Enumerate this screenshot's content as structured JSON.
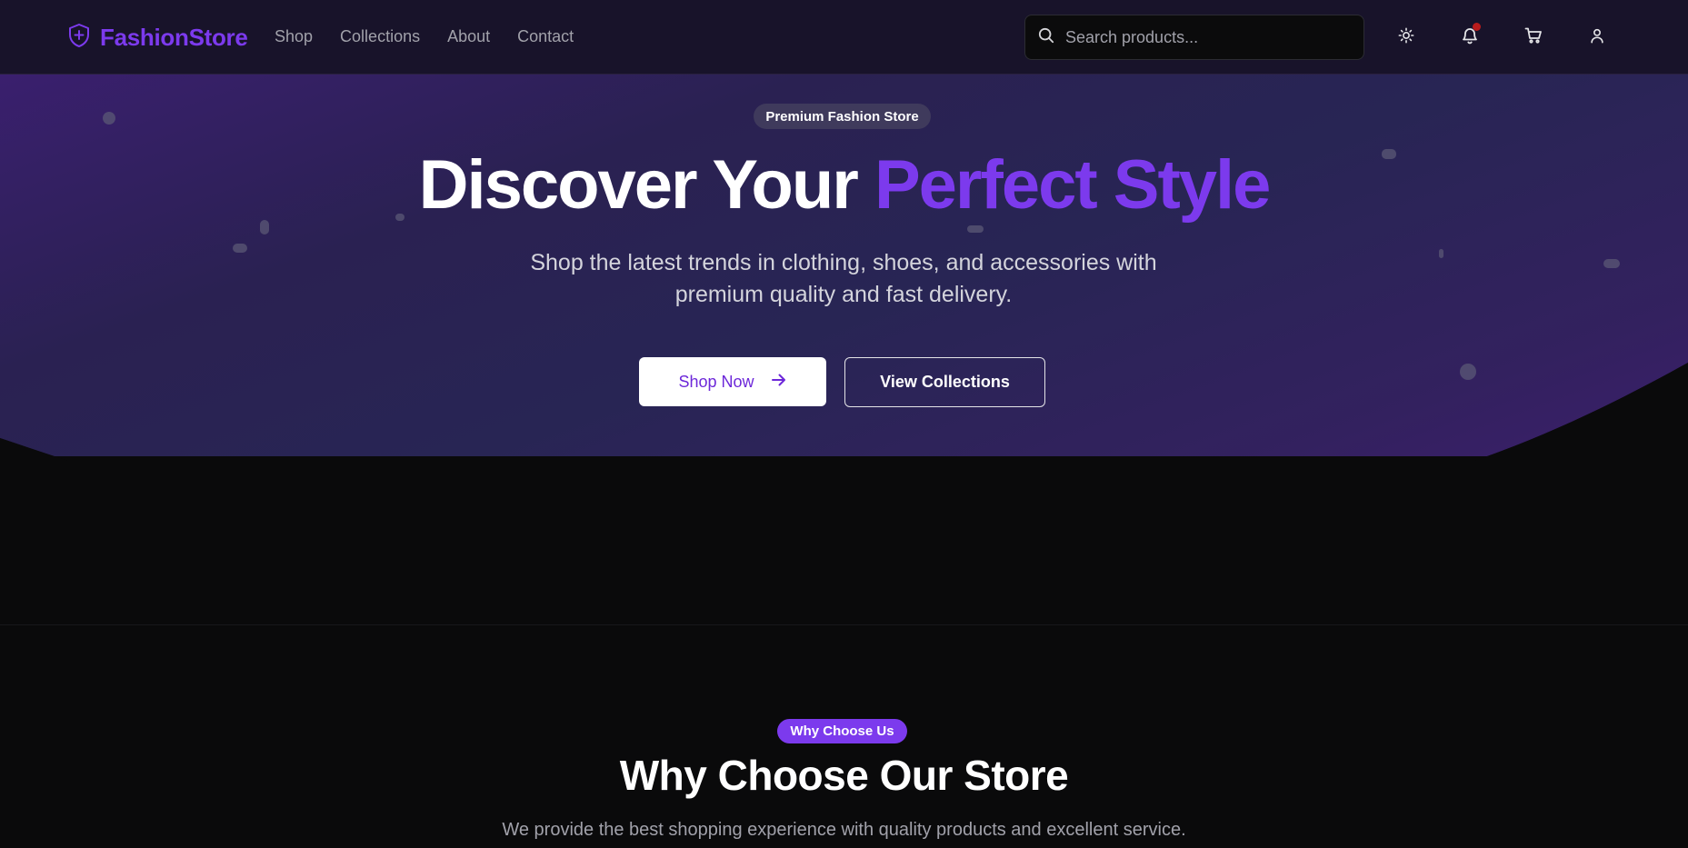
{
  "nav": {
    "brand": "FashionStore",
    "links": [
      "Shop",
      "Collections",
      "About",
      "Contact"
    ],
    "search_placeholder": "Search products...",
    "icons": [
      "theme-toggle-icon",
      "bell-icon",
      "cart-icon",
      "user-icon"
    ]
  },
  "hero": {
    "badge": "Premium Fashion Store",
    "title_main": "Discover Your ",
    "title_accent": "Perfect Style",
    "subtitle_line1": "Shop the latest trends in clothing, shoes, and accessories with",
    "subtitle_line2": "premium quality and fast delivery.",
    "primary_button": "Shop Now",
    "secondary_button": "View Collections"
  },
  "why": {
    "badge": "Why Choose Us",
    "title": "Why Choose Our Store",
    "subtitle": "We provide the best shopping experience with quality products and excellent service."
  },
  "colors": {
    "accent": "#7c3aed",
    "nav_bg": "#18132a",
    "page_bg": "#0a0a0b",
    "notification": "#b91c1c"
  }
}
